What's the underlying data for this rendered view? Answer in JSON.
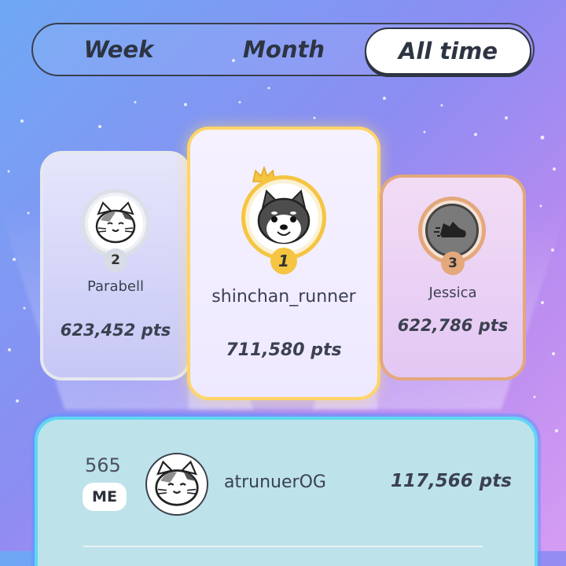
{
  "tabs": {
    "week": "Week",
    "month": "Month",
    "all_time": "All time",
    "selected": "All time"
  },
  "podium": {
    "first": {
      "rank": "1",
      "name": "shinchan_runner",
      "points": "711,580 pts",
      "avatar": "shiba-dog-icon"
    },
    "second": {
      "rank": "2",
      "name": "Parabell",
      "points": "623,452 pts",
      "avatar": "cat-icon"
    },
    "third": {
      "rank": "3",
      "name": "Jessica",
      "points": "622,786 pts",
      "avatar": "running-shoe-icon"
    }
  },
  "me": {
    "rank": "565",
    "tag": "ME",
    "name": "atrunuerOG",
    "points": "117,566 pts",
    "avatar": "cat-icon"
  },
  "colors": {
    "gold": "#f5c542",
    "silver": "#d8dce4",
    "bronze": "#e3a87c",
    "me_panel": "#bde2ea",
    "me_border": "#5fd7f2"
  }
}
